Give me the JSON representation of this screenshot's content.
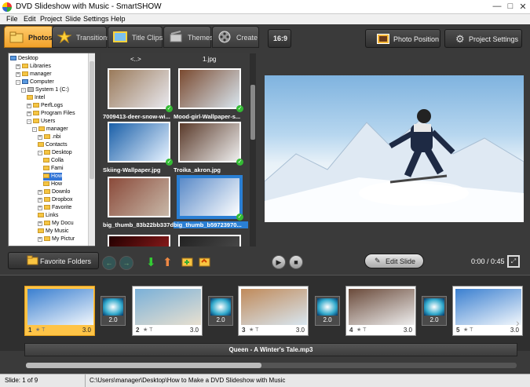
{
  "window": {
    "title": "DVD Slideshow with Music - SmartSHOW"
  },
  "menu": [
    "File",
    "Edit",
    "Project",
    "Slide",
    "Settings",
    "Help"
  ],
  "tabs": [
    {
      "label": "Photos",
      "icon": "folder-photo-icon",
      "active": true
    },
    {
      "label": "Transitions",
      "icon": "star-icon",
      "active": false
    },
    {
      "label": "Title Clips",
      "icon": "title-clip-icon",
      "active": false
    },
    {
      "label": "Themes",
      "icon": "themes-icon",
      "active": false
    },
    {
      "label": "Create",
      "icon": "film-reel-icon",
      "active": false
    }
  ],
  "toolbar": {
    "aspect_label": "16:9",
    "photo_position_label": "Photo Position",
    "project_settings_label": "Project Settings"
  },
  "tree": [
    {
      "label": "Desktop",
      "depth": 0,
      "icon": "desktop"
    },
    {
      "label": "Libraries",
      "depth": 1,
      "toggle": "+"
    },
    {
      "label": "manager",
      "depth": 1,
      "toggle": "+"
    },
    {
      "label": "Computer",
      "depth": 1,
      "toggle": "-",
      "icon": "computer"
    },
    {
      "label": "System 1 (C:)",
      "depth": 2,
      "toggle": "-",
      "icon": "drive"
    },
    {
      "label": "Intel",
      "depth": 3
    },
    {
      "label": "PerfLogs",
      "depth": 3,
      "toggle": "+"
    },
    {
      "label": "Program Files",
      "depth": 3,
      "toggle": "+"
    },
    {
      "label": "Users",
      "depth": 3,
      "toggle": "-"
    },
    {
      "label": "manager",
      "depth": 4,
      "toggle": "-"
    },
    {
      "label": ".nbi",
      "depth": 5,
      "toggle": "+"
    },
    {
      "label": "Contacts",
      "depth": 5
    },
    {
      "label": "Desktop",
      "depth": 5,
      "toggle": "-"
    },
    {
      "label": "Colla",
      "depth": 6
    },
    {
      "label": "Fami",
      "depth": 6
    },
    {
      "label": "How",
      "depth": 6,
      "selected": true
    },
    {
      "label": "How",
      "depth": 6
    },
    {
      "label": "Downlo",
      "depth": 5,
      "toggle": "+"
    },
    {
      "label": "Dropbox",
      "depth": 5,
      "toggle": "+"
    },
    {
      "label": "Favorite",
      "depth": 5,
      "toggle": "+"
    },
    {
      "label": "Links",
      "depth": 5
    },
    {
      "label": "My Docu",
      "depth": 5,
      "toggle": "+"
    },
    {
      "label": "My Music",
      "depth": 5
    },
    {
      "label": "My Pictur",
      "depth": 5,
      "toggle": "+"
    }
  ],
  "thumbs_header": {
    "parent": "<..>",
    "file": "1.jpg"
  },
  "thumbs": [
    {
      "label": "7009413-deer-snow-wi...",
      "colors": [
        "#9a7a5a",
        "#e8e8ee"
      ],
      "checked": true
    },
    {
      "label": "Mood-girl-Wallpaper-s...",
      "colors": [
        "#7a4a30",
        "#d9e6ef"
      ],
      "checked": true
    },
    {
      "label": "Skiing-Wallpaper.jpg",
      "colors": [
        "#1a5fa8",
        "#e6f2ff"
      ],
      "checked": true
    },
    {
      "label": "Troika_akron.jpg",
      "colors": [
        "#5a3a2a",
        "#eeeeee"
      ],
      "checked": true
    },
    {
      "label": "big_thumb_83b22bb337d5...",
      "colors": [
        "#8a4a3a",
        "#c8b8a8"
      ],
      "checked": false
    },
    {
      "label": "big_thumb_b59723970...",
      "colors": [
        "#5a8ac8",
        "#ffffff"
      ],
      "checked": true,
      "selected": true
    },
    {
      "label": "",
      "colors": [
        "#200",
        "#a22"
      ],
      "checked": false
    },
    {
      "label": "",
      "colors": [
        "#222",
        "#555"
      ],
      "checked": false
    }
  ],
  "favorites": {
    "label": "Favorite Folders"
  },
  "nav_icons": [
    "back-arrow-icon",
    "forward-arrow-icon",
    "move-down-icon",
    "move-up-icon",
    "folder-add-icon",
    "folder-open-icon"
  ],
  "player": {
    "edit_label": "Edit Slide",
    "time": "0:00 / 0:45"
  },
  "slides": [
    {
      "num": "1",
      "dur": "3.0",
      "colors": [
        "#3a7fd0",
        "#f2f7fc"
      ]
    },
    {
      "num": "2",
      "dur": "3.0",
      "colors": [
        "#7ab0d8",
        "#e8e0d0"
      ]
    },
    {
      "num": "3",
      "dur": "3.0",
      "colors": [
        "#c08a5a",
        "#d8e6f0"
      ]
    },
    {
      "num": "4",
      "dur": "3.0",
      "colors": [
        "#6a4a3a",
        "#eeeeee"
      ]
    },
    {
      "num": "5",
      "dur": "3.0",
      "colors": [
        "#3a7fd0",
        "#f2f7fc"
      ]
    }
  ],
  "transitions": [
    "2.0",
    "2.0",
    "2.0",
    "2.0"
  ],
  "audio": {
    "track": "Queen - A Winter's Tale.mp3"
  },
  "status": {
    "slide": "Slide: 1 of 9",
    "path": "C:\\Users\\manager\\Desktop\\How to Make a DVD Slideshow with Music"
  },
  "colors": {
    "accent": "#f2a22a",
    "selection": "#2a7fd4"
  }
}
